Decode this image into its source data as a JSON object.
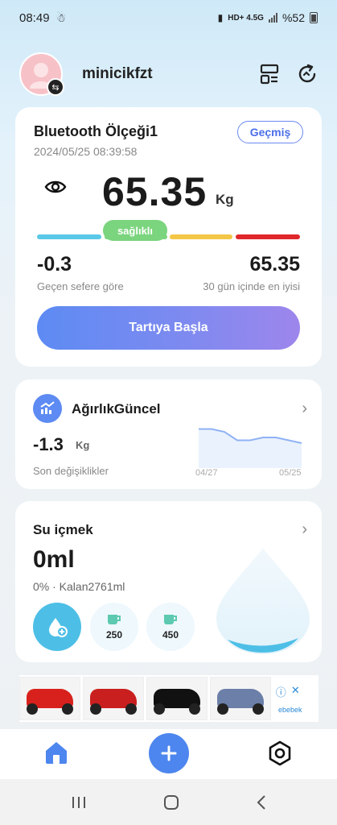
{
  "status": {
    "time": "08:49",
    "network": "HD+ 4.5G",
    "battery": "%52"
  },
  "header": {
    "username": "minicikfzt"
  },
  "scale": {
    "title": "Bluetooth Ölçeği1",
    "date": "2024/05/25 08:39:58",
    "history_label": "Geçmiş",
    "weight": "65.35",
    "unit": "Kg",
    "health": "sağlıklı",
    "health_level": 2,
    "change_value": "-0.3",
    "change_label": "Geçen sefere göre",
    "best_value": "65.35",
    "best_label": "30 gün içinde en iyisi",
    "start_label": "Tartıya Başla"
  },
  "weight_trend": {
    "title": "AğırlıkGüncel",
    "value": "-1.3",
    "unit": "Kg",
    "label": "Son değişiklikler",
    "x_start": "04/27",
    "x_end": "05/25",
    "points": [
      66.6,
      66.6,
      66.5,
      66.2,
      66.2,
      66.3,
      66.3,
      66.2,
      66.1
    ]
  },
  "water": {
    "title": "Su içmek",
    "amount": "0ml",
    "subtitle": "0% · Kalan2761ml",
    "cups": [
      "250",
      "450"
    ]
  },
  "ad": {
    "brand": "ebebek"
  },
  "colors": {
    "accent": "#4d86ee",
    "healthy": "#7bd47e",
    "under": "#5ac8e8",
    "over": "#f4c646",
    "obese": "#e0272b",
    "water": "#4dbfe6"
  },
  "icons": [
    "swap-icon",
    "device-list-icon",
    "refresh-icon",
    "eye-icon",
    "trend-icon",
    "chevron-right-icon",
    "water-drop-add-icon",
    "cup-icon",
    "home-icon",
    "plus-icon",
    "settings-icon"
  ]
}
